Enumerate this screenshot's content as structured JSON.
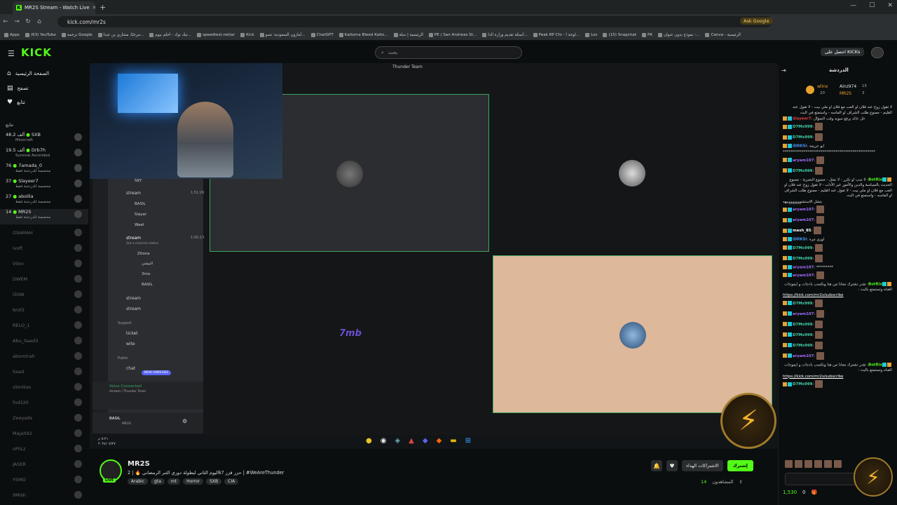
{
  "browser": {
    "tab_title": "MR2S Stream - Watch Live",
    "url": "kick.com/mr2s",
    "ask_google": "Ask Google",
    "bookmarks": [
      "Apps",
      "(63) YouTube",
      "ترجمة Google",
      "مرحبًا، مشاري بن عبدا...",
      "تيك توك - احلم بيوم...",
      "speedtest.net/ar",
      "Kick",
      "أمازون السعودية: تسو...",
      "ChatGPT",
      "Kaitoma Bleed Kaito...",
      "الرئيسية | سلة",
      "PE | San Andreas St...",
      "أسئلة تقديم وزارة الدا...",
      "Peak RP Chi - لوحة ا...",
      "Los",
      "(15) Snapchat",
      "PK",
      "نموذج بدون عنوان -...",
      "Canva - الرئيسية"
    ]
  },
  "header": {
    "logo": "KICK",
    "search_placeholder": "بحث",
    "get_kicks": "احصل على KICKs"
  },
  "sidebar": {
    "nav": [
      "الصفحة الرئيسية",
      "تصفح",
      "تتابع"
    ],
    "section": "تتابع",
    "live": [
      {
        "name": "SXB",
        "count": "48.2 ألف",
        "sub": "Minecraft"
      },
      {
        "name": "Drb7h",
        "count": "19.5 ألف",
        "sub": "Survival Ascended"
      },
      {
        "name": "7amada_0",
        "count": "76",
        "sub": "مخصصة للدردشة فقط"
      },
      {
        "name": "Slayeer7",
        "count": "37",
        "sub": "مخصصة للدردشة فقط"
      },
      {
        "name": "abolila",
        "count": "27",
        "sub": "مخصصة للدردشة فقط"
      },
      {
        "name": "MR2S",
        "count": "14",
        "sub": "مخصصة للدردشة فقط"
      }
    ],
    "offline": [
      "OSAMAH",
      "ivoft",
      "Vilon",
      "DWEM",
      "I3SW",
      "brof2",
      "RELO_1",
      "Abu_Saad3",
      "abomtrah",
      "Saad",
      "sSmitoo",
      "fnd320",
      "Zeeyadx",
      "Majah92",
      "oPiiLz",
      "JASER",
      "YSMO",
      "9Mish"
    ]
  },
  "player": {
    "discord_title": "Thunder Team",
    "voice_connected": "Voice Connected",
    "voice_sub": "stream / Thunder Team",
    "user": "BASIL",
    "user_tag": "MR2S",
    "channels": [
      "stream",
      "stream",
      "stream",
      "ticket",
      "wite",
      "chat"
    ],
    "members": [
      "SKY",
      "BASIL",
      "Slayer",
      "Wael",
      "Zitona",
      "البيشي",
      "3mo",
      "BASIL"
    ],
    "new_unreads": "NEW UNREADS",
    "support": "Support",
    "public": "Public",
    "set_status": "Set a channel status",
    "time1": "1:51:26",
    "time2": "1:50:13",
    "tile_text": "7mb",
    "clock": "٥:٢١ م",
    "date": "٢٠٢٤/٠٧/٢٧"
  },
  "stream": {
    "channel": "MR2S",
    "live_badge": "LIVE",
    "title": "اليوم الثاني لبطولة دوري الثنر الرمضاني 🔥 | 2k? حزر قزر | #WeAreThunder",
    "tags": [
      "Arabic",
      "gta",
      "mt",
      "Horror",
      "SXB",
      "CIA"
    ],
    "subscriptions": "الاشتراكات الهداء",
    "follow": "إشترك",
    "viewers_label": "المشاهدون",
    "viewers": "14"
  },
  "chat": {
    "title": "الدردشة",
    "top_users": [
      "wlinx",
      "Ainz974",
      "MR2S"
    ],
    "top_counts": [
      "15",
      "20",
      "3"
    ],
    "messages": [
      {
        "u": "",
        "t": "لا تقول زوج عند فلان او العب مع فلان او ملي بيت - لا تقول عنه القليم - ممنوع طلب الشراف او الماسه - واستمتع في البث",
        "c": "#ddd"
      },
      {
        "u": "Slayeer7",
        "t": "خل خالد يرفع سوبه وقت السؤال",
        "c": "#e04040"
      },
      {
        "u": "D7Mx999",
        "t": "",
        "c": "#43d1a8",
        "e": 1
      },
      {
        "u": "D7Mx999",
        "t": "",
        "c": "#43d1a8",
        "e": 1
      },
      {
        "u": "iDRKSi",
        "t": "ابو جريمه",
        "c": "#4a9aff"
      },
      {
        "u": "",
        "t": "*************************************************",
        "c": "#ddd"
      },
      {
        "u": "aryam107",
        "t": "",
        "c": "#a46cff",
        "e": 1
      },
      {
        "u": "D7Mx999",
        "t": "",
        "c": "#43d1a8",
        "e": 1
      },
      {
        "u": "BotRix",
        "t": "لا سب او تكرر - لا تمثل - ممنوع النصرية - ممنوع الحديث بالسياسة والدين والأمور غير الأداب - لا تقول زوج عند فلان او العب مع فلان او ملي بيت - لا تقول عنه القليم - ممنوع طلب الشراف او الماسه - واستمتع في البث",
        "c": "#53fc18"
      },
      {
        "u": "",
        "t": "بتشل الاستشوووووووييهه",
        "c": "#ddd"
      },
      {
        "u": "aryam107",
        "t": "",
        "c": "#a46cff",
        "e": 1
      },
      {
        "u": "aryam107",
        "t": "",
        "c": "#a46cff",
        "e": 1
      },
      {
        "u": "mesh_85",
        "t": "",
        "c": "#fff",
        "e": 1
      },
      {
        "u": "iDRKSi",
        "t": "اوزي مره",
        "c": "#4a9aff"
      },
      {
        "u": "D7Mx999",
        "t": "",
        "c": "#43d1a8",
        "e": 1
      },
      {
        "u": "D7Mx999",
        "t": "",
        "c": "#43d1a8",
        "e": 1
      },
      {
        "u": "aryam107",
        "t": "*********",
        "c": "#a46cff"
      },
      {
        "u": "aryam107",
        "t": "",
        "c": "#a46cff",
        "e": 1
      },
      {
        "u": "BotRix",
        "t": "تقدر تشترك معانا من هنا وتكسب بادجات و ايموجات القناه وتستمتع بالبث :",
        "c": "#53fc18"
      },
      {
        "u": "",
        "t": "https://kick.com/mr2s/subscribe",
        "c": "#fff",
        "link": 1
      },
      {
        "u": "D7Mx999",
        "t": "",
        "c": "#43d1a8",
        "e": 1
      },
      {
        "u": "aryam107",
        "t": "",
        "c": "#a46cff",
        "e": 1
      },
      {
        "u": "D7Mx999",
        "t": "",
        "c": "#43d1a8",
        "e": 1
      },
      {
        "u": "D7Mx999",
        "t": "",
        "c": "#43d1a8",
        "e": 1
      },
      {
        "u": "D7Mx999",
        "t": "",
        "c": "#43d1a8",
        "e": 1
      },
      {
        "u": "aryam107",
        "t": "",
        "c": "#a46cff",
        "e": 1
      },
      {
        "u": "BotRix",
        "t": "تقدر تشترك معانا من هنا وتكسب بادجات و ايموجات القناه وتستمتع بالبث :",
        "c": "#53fc18"
      },
      {
        "u": "",
        "t": "https://kick.com/mr2s/subscribe",
        "c": "#fff",
        "link": 1
      },
      {
        "u": "D7Mx999",
        "t": "",
        "c": "#43d1a8",
        "e": 1
      }
    ],
    "points": "1,530",
    "zero": "0"
  },
  "colors": {
    "accent": "#53fc18",
    "bg": "#0b0e0f",
    "discord": "#2b2d31",
    "speaking": "#3ba55d"
  }
}
